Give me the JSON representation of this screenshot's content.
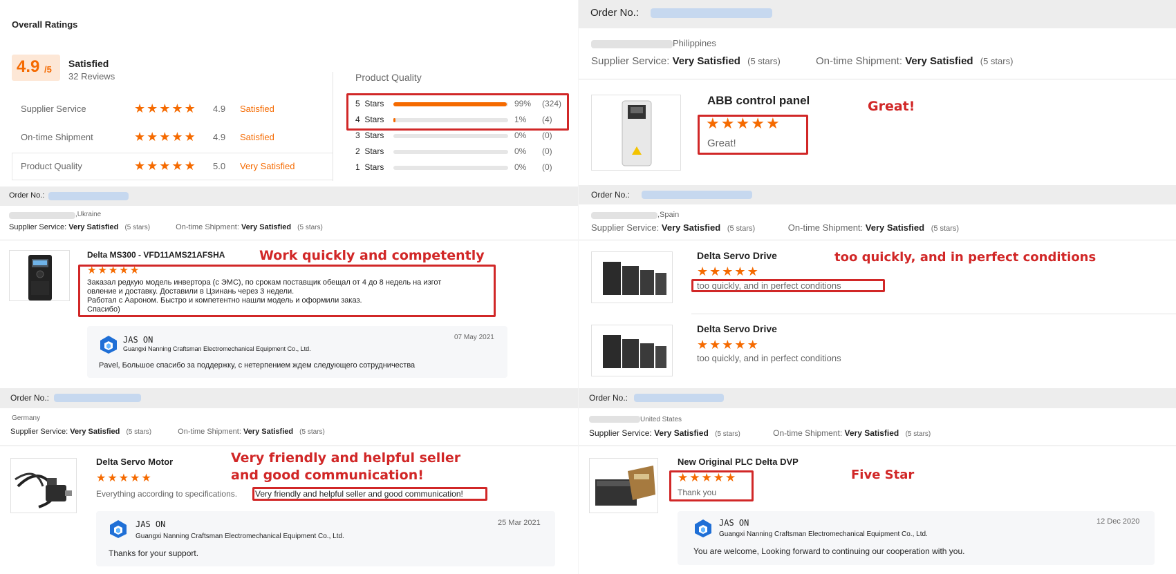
{
  "overall": {
    "title": "Overall Ratings",
    "score": "4.9",
    "score_suffix": "/5",
    "label": "Satisfied",
    "reviews": "32 Reviews",
    "metrics": [
      {
        "name": "Supplier Service",
        "score": "4.9",
        "label": "Satisfied"
      },
      {
        "name": "On-time Shipment",
        "score": "4.9",
        "label": "Satisfied"
      },
      {
        "name": "Product Quality",
        "score": "5.0",
        "label": "Very Satisfied"
      }
    ],
    "pq_title": "Product Quality",
    "distribution": [
      {
        "label": "5  Stars",
        "pct": "99%",
        "count": "(324)",
        "fill": 0.99
      },
      {
        "label": "4  Stars",
        "pct": "1%",
        "count": "(4)",
        "fill": 0.02
      },
      {
        "label": "3  Stars",
        "pct": "0%",
        "count": "(0)",
        "fill": 0
      },
      {
        "label": "2  Stars",
        "pct": "0%",
        "count": "(0)",
        "fill": 0
      },
      {
        "label": "1  Stars",
        "pct": "0%",
        "count": "(0)",
        "fill": 0
      }
    ]
  },
  "common": {
    "order_no": "Order No.:",
    "supplier_service": "Supplier Service:",
    "ontime_shipment": "On-time Shipment:",
    "very_satisfied": "Very Satisfied",
    "five_stars": "(5 stars)",
    "star_glyph": "★",
    "rating_value": 5,
    "replier": "JAS ON",
    "company": "Guangxi Nanning Craftsman Electromechanical Equipment Co., Ltd."
  },
  "reviews": {
    "ukraine": {
      "country": ",Ukraine",
      "product": "Delta MS300 - VFD11AMS21AFSHA",
      "annotation": "Work quickly and competently",
      "text_lines": [
        "Заказал редкую модель инвертора (с ЭМС), по срокам поставщик обещал от 4 до 8 недель на изгот",
        "овление и доставку. Доставили в Цзинань через 3 недели.",
        "Работал с Аароном. Быстро и компетентно нашли модель и оформили заказ.",
        "Спасибо)"
      ],
      "reply_date": "07 May 2021",
      "reply_text": "Pavel, Большое спасибо за поддержку, с нетерпением ждем следующего сотрудничества"
    },
    "germany": {
      "country": "Germany",
      "product": "Delta Servo Motor",
      "annotation_line1": "Very friendly and helpful seller",
      "annotation_line2": "and good communication!",
      "text_prefix": "Everything according to specifications.",
      "text_highlight": "Very friendly and helpful seller and good communication!",
      "reply_date": "25 Mar 2021",
      "reply_text": "Thanks for your support."
    },
    "philippines": {
      "country": "Philippines",
      "product": "ABB control panel",
      "annotation": "Great!",
      "text": "Great!"
    },
    "spain": {
      "country": ",Spain",
      "product1": "Delta Servo Drive",
      "annotation": "too quickly, and in perfect conditions",
      "text1": "too quickly, and in perfect conditions",
      "product2": "Delta Servo Drive",
      "text2": "too quickly, and in perfect conditions"
    },
    "us": {
      "country": "United States",
      "product": "New Original PLC Delta DVP",
      "annotation": "Five Star",
      "text": "Thank you",
      "reply_date": "12 Dec 2020",
      "reply_text": "You are welcome, Looking forward to continuing our cooperation with you."
    }
  },
  "colors": {
    "star": "#f56a00",
    "annotation": "#d12727",
    "score_bg": "#fde7d6"
  }
}
